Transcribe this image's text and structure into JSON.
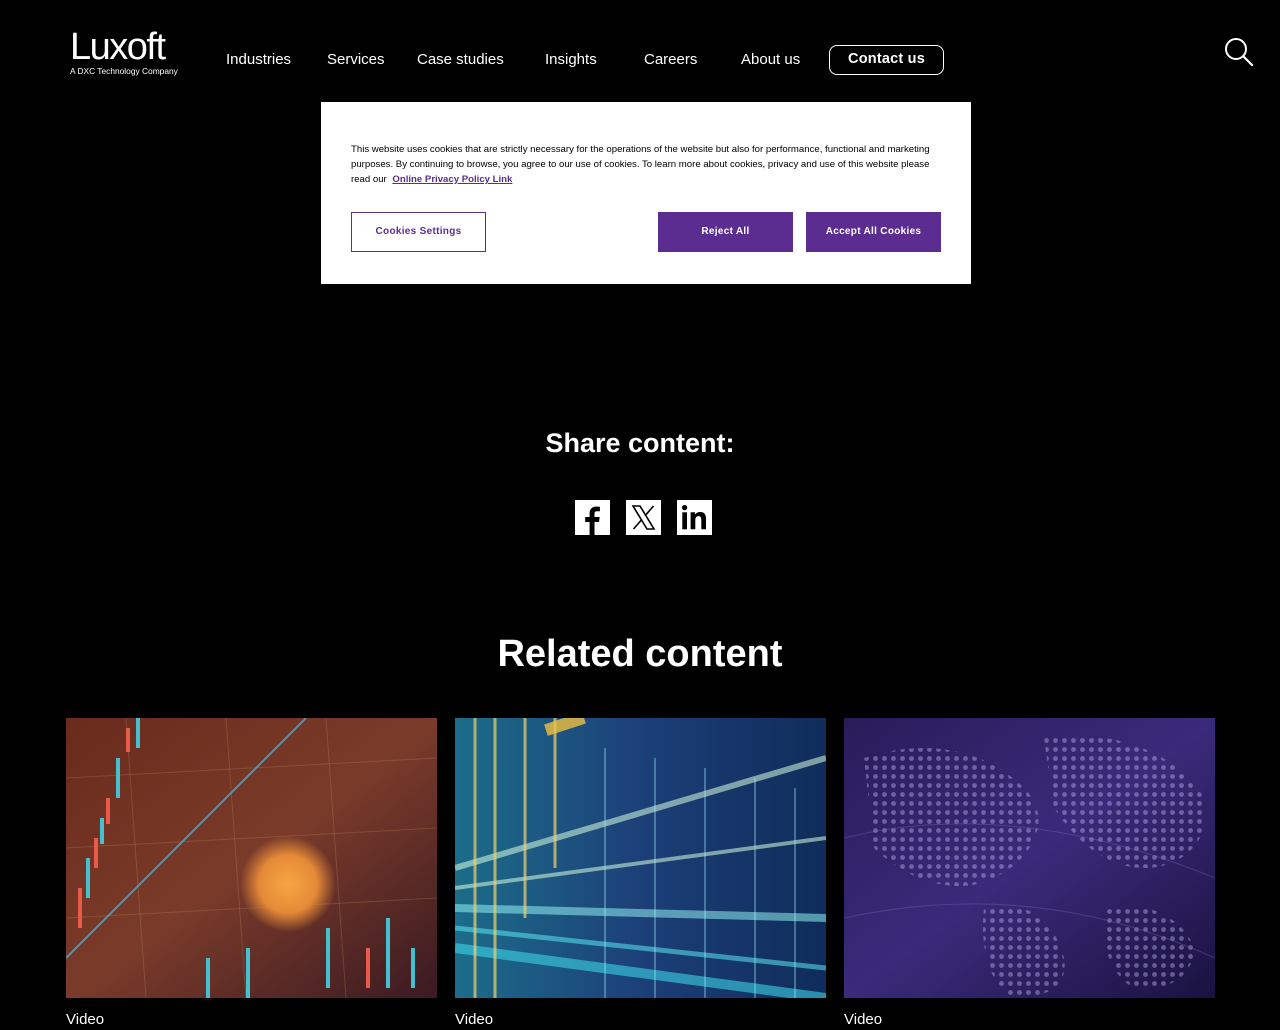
{
  "header": {
    "logo_text": "Luxoft",
    "logo_subtitle": "A DXC Technology Company",
    "nav": [
      {
        "label": "Industries"
      },
      {
        "label": "Services"
      },
      {
        "label": "Case studies"
      },
      {
        "label": "Insights"
      },
      {
        "label": "Careers"
      },
      {
        "label": "About us"
      }
    ],
    "contact_label": "Contact us",
    "search_icon": "search-icon"
  },
  "cookie_banner": {
    "text": "This website uses cookies that are strictly necessary for the operations of the website but also for performance, functional and marketing purposes. By continuing to browse, you agree to our use of cookies. To learn more about cookies, privacy and use of this website please read our",
    "link_text": "Online Privacy Policy Link",
    "settings_label": "Cookies Settings",
    "reject_label": "Reject All",
    "accept_label": "Accept All Cookies",
    "accent_color": "#5c2d91"
  },
  "share": {
    "title": "Share content:",
    "icons": [
      "facebook-icon",
      "x-icon",
      "linkedin-icon"
    ]
  },
  "related": {
    "title": "Related content",
    "cards": [
      {
        "type_label": "Video",
        "image": "financial-chart-image"
      },
      {
        "type_label": "Video",
        "image": "data-light-streams-image"
      },
      {
        "type_label": "Video",
        "image": "digital-world-map-image"
      }
    ]
  }
}
